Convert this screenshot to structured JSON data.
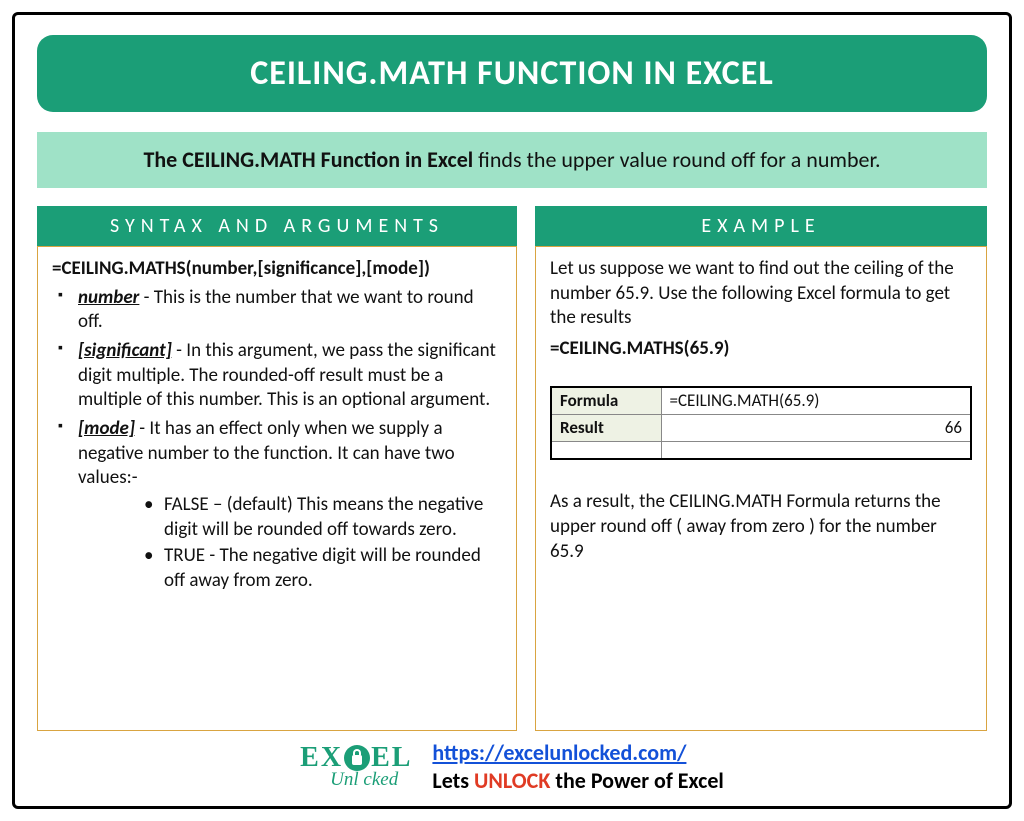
{
  "title": "CEILING.MATH FUNCTION IN EXCEL",
  "intro": {
    "bold": "The CEILING.MATH Function in Excel",
    "rest": " finds the upper value round off for a number."
  },
  "syntax": {
    "header": "SYNTAX AND ARGUMENTS",
    "formula": "=CEILING.MATHS(number,[significance],[mode])",
    "args": [
      {
        "name": "number",
        "desc": " - This is the number that we want to round off."
      },
      {
        "name": "[significant]",
        "desc": " - In this argument, we pass the significant digit multiple. The rounded-off result must be a multiple of this number. This is an optional argument."
      },
      {
        "name": "[mode]",
        "desc": " - It has an effect only when we supply a negative number to the function. It can have two values:-"
      }
    ],
    "mode_values": [
      "FALSE – (default) This means the negative digit will be rounded off towards zero.",
      "TRUE - The negative digit will be rounded off away from zero."
    ]
  },
  "example": {
    "header": "EXAMPLE",
    "para1": "Let us suppose we want to find out the ceiling of the number 65.9. Use the following Excel formula to get the results",
    "formula_line": "=CEILING.MATHS(65.9)",
    "table": {
      "r1h": "Formula",
      "r1v": "=CEILING.MATH(65.9)",
      "r2h": "Result",
      "r2v": "66"
    },
    "para2": "As a result, the CEILING.MATH Formula returns the upper round off ( away from zero ) for the number 65.9"
  },
  "footer": {
    "logo_top_left": "EX",
    "logo_top_right": "EL",
    "logo_bottom": "Unl   cked",
    "url": "https://excelunlocked.com/",
    "tag_pre": "Lets ",
    "tag_em": "UNLOCK",
    "tag_post": " the Power of Excel"
  }
}
